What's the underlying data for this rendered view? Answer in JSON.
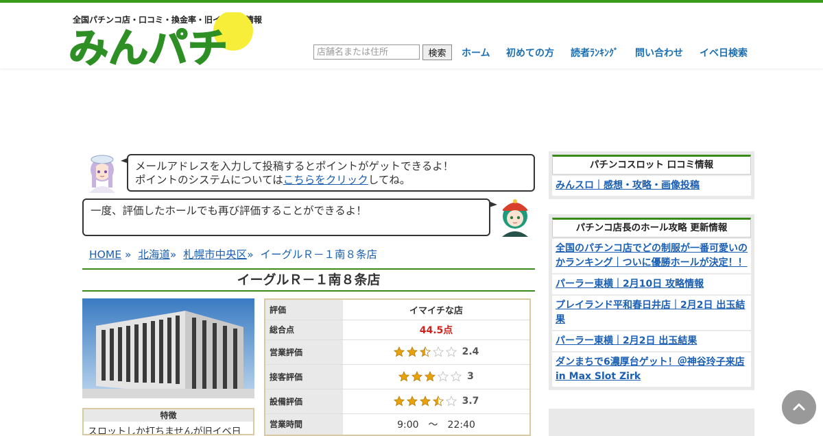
{
  "header": {
    "tagline": "全国パチンコ店・口コミ・換金率・旧イベント情報",
    "logo_text": "みんパチ",
    "search_placeholder": "店舗名または住所",
    "search_button": "検索",
    "nav": [
      "ホーム",
      "初めての方",
      "読者ﾗﾝｷﾝｸﾞ",
      "問い合わせ",
      "イベ日検索"
    ]
  },
  "bubbles": {
    "first_line1": "メールアドレスを入力して投稿するとポイントがゲットできるよ！",
    "first_line2_pre": "ポイントのシステムについては",
    "first_link": "こちらをクリック",
    "first_line2_post": "してね。",
    "second": "一度、評価したホールでも再び評価することができるよ！"
  },
  "breadcrumb": {
    "home": "HOME",
    "pref": "北海道",
    "city": "札幌市中央区",
    "current": "イーグルＲ－１南８条店",
    "sep": "»"
  },
  "store": {
    "title": "イーグルＲ－１南８条店",
    "feature_head": "特徴",
    "feature_body": "スロットしか打ちませんが旧イベ日",
    "rows": {
      "eval_label": "評価",
      "eval_value": "イマイチな店",
      "total_label": "総合点",
      "total_value": "44.5点",
      "business_label": "営業評価",
      "business_score": "2.4",
      "service_label": "接客評価",
      "service_score": "3",
      "facility_label": "設備評価",
      "facility_score": "3.7",
      "hours_label": "営業時間",
      "hours_value": "9:00　～　22:40"
    },
    "ratings": {
      "business": 2.4,
      "service": 3,
      "facility": 3.7
    }
  },
  "sidebar": {
    "box1_head": "パチンコスロット 口コミ情報",
    "box1_items": [
      "みんスロ｜感想・攻略・画像投稿"
    ],
    "box2_head": "パチンコ店長のホール攻略 更新情報",
    "box2_items": [
      "全国のパチンコ店でどの制服が一番可愛いのかランキング｜ついに優勝ホールが決定！！",
      "パーラー東横｜2月10日 攻略情報",
      "プレイランド平和春日井店｜2月2日 出玉結果",
      "パーラー東横｜2月2日 出玉結果",
      "ダンまちで6濃厚台ゲット！＠神谷玲子来店in Max Slot Zirk"
    ]
  },
  "colors": {
    "brand_green": "#3a9a1a",
    "link_blue": "#1a5fb4",
    "star_gold": "#e8a20c",
    "total_red": "#d0211a"
  },
  "icons": {
    "back_to_top": "chevron-up-icon",
    "star": "star-icon"
  }
}
